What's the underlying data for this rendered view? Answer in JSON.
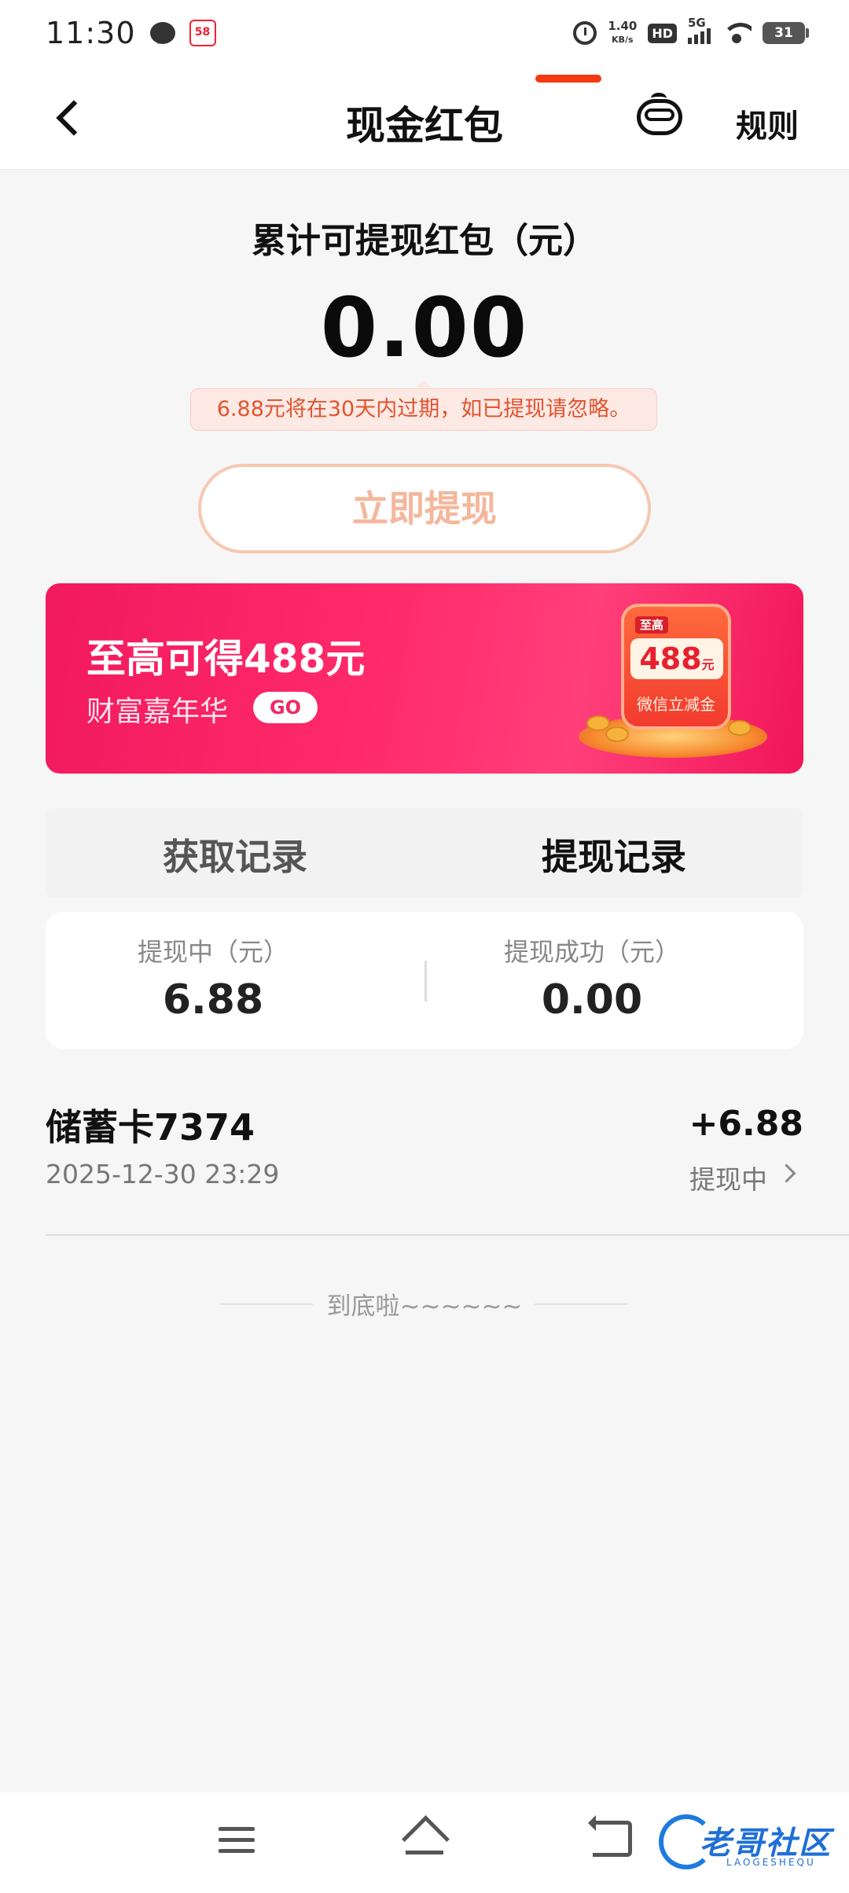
{
  "status_bar": {
    "time": "11:30",
    "speed_value": "1.40",
    "speed_unit": "KB/s",
    "hd": "HD",
    "network": "5G",
    "battery": "31",
    "app_badge": "58"
  },
  "nav": {
    "title": "现金红包",
    "rules_label": "规则"
  },
  "summary": {
    "title": "累计可提现红包（元）",
    "amount": "0.00",
    "expire_note": "6.88元将在30天内过期，如已提现请忽略。",
    "withdraw_button": "立即提现"
  },
  "promo": {
    "title": "至高可得488元",
    "subtitle": "财富嘉年华",
    "go_label": "GO",
    "badge_top": "至高",
    "badge_amount": "488",
    "badge_unit": "元",
    "badge_foot": "微信立减金"
  },
  "tabs": [
    {
      "label": "获取记录",
      "active": false
    },
    {
      "label": "提现记录",
      "active": true
    }
  ],
  "stats": {
    "pending_label": "提现中（元）",
    "pending_value": "6.88",
    "success_label": "提现成功（元）",
    "success_value": "0.00"
  },
  "records": [
    {
      "name": "储蓄卡7374",
      "amount": "+6.88",
      "time": "2025-12-30 23:29",
      "status": "提现中"
    }
  ],
  "end_text": "到底啦~~~~~~",
  "watermark": {
    "brand": "老哥社区",
    "brand_en": "LAOGESHEQU"
  },
  "colors": {
    "accent": "#f23a12",
    "promo_pink": "#f2195f",
    "note_text": "#e1542f",
    "button_text": "#f4b79b"
  }
}
